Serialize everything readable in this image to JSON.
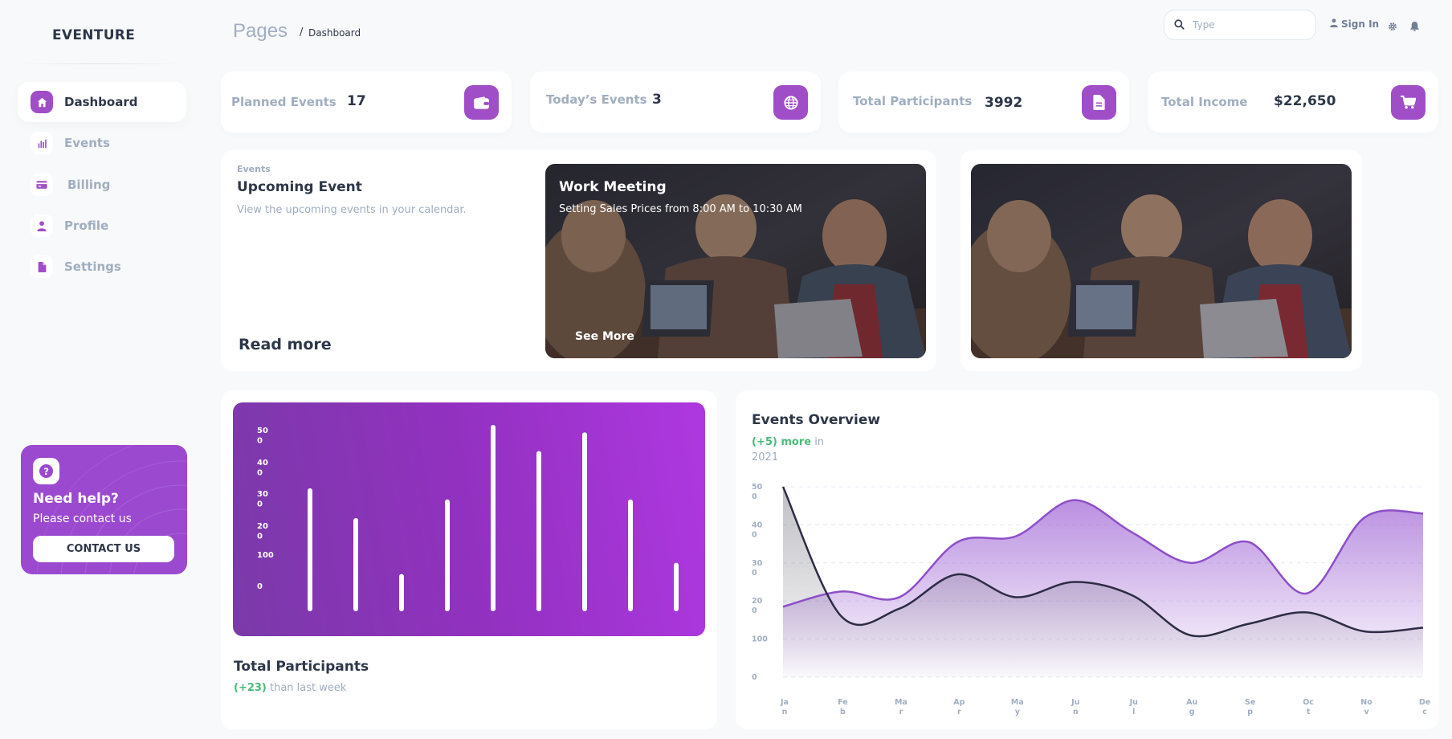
{
  "brand": "EVENTURE",
  "sidebar": {
    "items": [
      {
        "label": "Dashboard",
        "icon": "home-icon",
        "active": true
      },
      {
        "label": "Events",
        "icon": "bar-chart-icon",
        "active": false
      },
      {
        "label": "Billing",
        "icon": "credit-card-icon",
        "active": false
      },
      {
        "label": "Profile",
        "icon": "person-icon",
        "active": false
      },
      {
        "label": "Settings",
        "icon": "document-icon",
        "active": false
      }
    ],
    "help": {
      "title": "Need help?",
      "subtitle": "Please contact us",
      "button": "CONTACT US"
    }
  },
  "header": {
    "breadcrumb_root": "Pages",
    "breadcrumb_sep": "/",
    "breadcrumb_current": "Dashboard",
    "search_placeholder": "Type",
    "signin_label": "Sign In"
  },
  "stats": [
    {
      "label": "Planned Events",
      "value": "17",
      "icon": "wallet-icon"
    },
    {
      "label": "Today’s Events",
      "value": "3",
      "icon": "globe-icon"
    },
    {
      "label": "Total Participants",
      "value": "3992",
      "icon": "document-icon"
    },
    {
      "label": "Total Income",
      "value": "$22,650",
      "icon": "cart-icon"
    }
  ],
  "upcoming": {
    "small_label": "Events",
    "title": "Upcoming Event",
    "description": "View the upcoming events in your calendar.",
    "read_more": "Read more",
    "photo_title": "Work Meeting",
    "photo_subtitle": "Setting Sales Prices from 8:00 AM to 10:30 AM",
    "photo_link": "See More"
  },
  "participants": {
    "title": "Total Participants",
    "change": "(+23)",
    "change_suffix": " than last week",
    "chart_data": {
      "type": "bar",
      "y_tick_labels": [
        [
          "50",
          "0"
        ],
        [
          "40",
          "0"
        ],
        [
          "30",
          "0"
        ],
        [
          "20",
          "0"
        ],
        [
          "100"
        ],
        [
          "0"
        ]
      ],
      "values": [
        330,
        250,
        100,
        300,
        500,
        430,
        480,
        300,
        130
      ],
      "ylim": [
        0,
        500
      ],
      "color": "#ffffff"
    }
  },
  "overview": {
    "title": "Events Overview",
    "change": "(+5) more",
    "change_suffix": " in 2021",
    "chart_data": {
      "type": "area",
      "x": [
        "Jan",
        "Feb",
        "Mar",
        "Apr",
        "May",
        "Jun",
        "Jul",
        "Aug",
        "Sep",
        "Oct",
        "Nov",
        "Dec"
      ],
      "x_tick_labels": [
        [
          "Ja",
          "n"
        ],
        [
          "Fe",
          "b"
        ],
        [
          "Ma",
          "r"
        ],
        [
          "Ap",
          "r"
        ],
        [
          "Ma",
          "y"
        ],
        [
          "Ju",
          "n"
        ],
        [
          "Ju",
          "l"
        ],
        [
          "Au",
          "g"
        ],
        [
          "Se",
          "p"
        ],
        [
          "Oc",
          "t"
        ],
        [
          "No",
          "v"
        ],
        [
          "De",
          "c"
        ]
      ],
      "y_tick_labels": [
        [
          "50",
          "0"
        ],
        [
          "40",
          "0"
        ],
        [
          "30",
          "0"
        ],
        [
          "20",
          "0"
        ],
        [
          "100"
        ],
        [
          "0"
        ]
      ],
      "ylim": [
        0,
        500
      ],
      "series": [
        {
          "values": [
            185,
            225,
            210,
            355,
            370,
            465,
            380,
            300,
            355,
            220,
            420,
            430
          ],
          "color": "#8e4fc8"
        },
        {
          "values": [
            500,
            160,
            180,
            270,
            210,
            250,
            215,
            110,
            140,
            170,
            120,
            130
          ],
          "color": "#2d2d45"
        }
      ]
    }
  },
  "colors": {
    "accent": "#a04ec8",
    "positive": "#48bb78",
    "muted": "#a0aec0"
  }
}
